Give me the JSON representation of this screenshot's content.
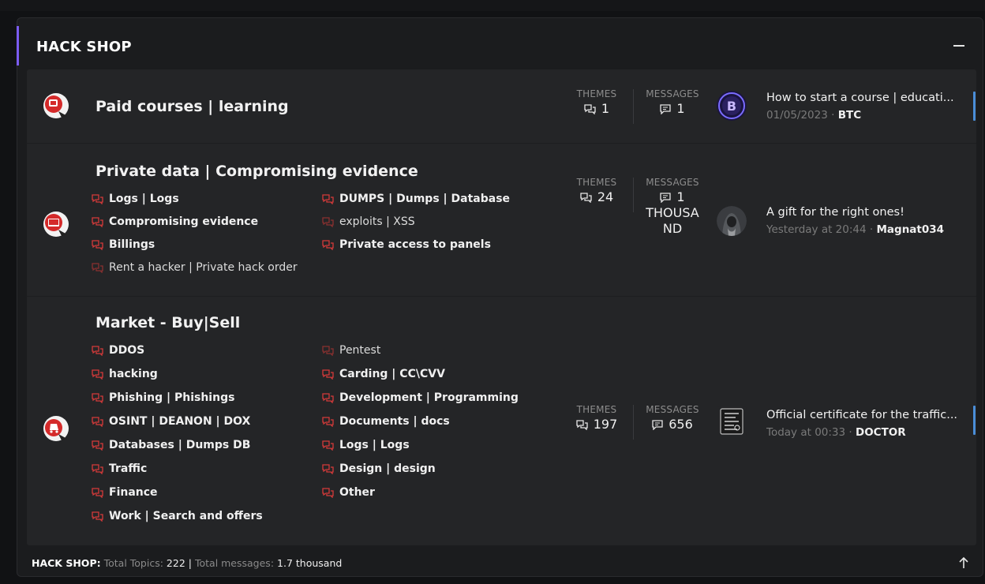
{
  "section": {
    "title": "HACK SHOP",
    "accent_color": "#7b5cf0",
    "collapse_icon": "minus-icon"
  },
  "forums": [
    {
      "title": "Paid courses | learning",
      "icon": "forum-courses-icon",
      "subforums_left": [],
      "subforums_right": [],
      "themes_label": "THEMES",
      "themes": "1",
      "messages_label": "MESSAGES",
      "messages": "1",
      "last_post": {
        "title": "How to start a course | educati...",
        "date": "01/05/2023",
        "sep": "·",
        "author": "BTC",
        "avatar": "btc-avatar"
      }
    },
    {
      "title": "Private data | Compromising evidence",
      "icon": "forum-private-data-icon",
      "subforums_left": [
        {
          "label": "Logs | Logs",
          "bold": true
        },
        {
          "label": "Compromising evidence",
          "bold": true
        },
        {
          "label": "Billings",
          "bold": true
        },
        {
          "label": "Rent a hacker | Private hack order",
          "bold": false
        }
      ],
      "subforums_right": [
        {
          "label": "DUMPS | Dumps | Database",
          "bold": true
        },
        {
          "label": "exploits | XSS",
          "bold": false
        },
        {
          "label": "Private access to panels",
          "bold": true
        }
      ],
      "themes_label": "THEMES",
      "themes": "24",
      "messages_label": "MESSAGES",
      "messages": "1",
      "messages_line2": "THOUSA",
      "messages_line3": "ND",
      "last_post": {
        "title": "A gift for the right ones!",
        "date": "Yesterday at 20:44",
        "sep": "·",
        "author": "Magnat034",
        "avatar": "hooded-figure-avatar"
      }
    },
    {
      "title": "Market - Buy|Sell",
      "icon": "forum-market-icon",
      "subforums_left": [
        {
          "label": "DDOS",
          "bold": true
        },
        {
          "label": "hacking",
          "bold": true
        },
        {
          "label": "Phishing | Phishings",
          "bold": true
        },
        {
          "label": "OSINT | DEANON | DOX",
          "bold": true
        },
        {
          "label": "Databases | Dumps DB",
          "bold": true
        },
        {
          "label": "Traffic",
          "bold": true
        },
        {
          "label": "Finance",
          "bold": true
        },
        {
          "label": "Work | Search and offers",
          "bold": true
        }
      ],
      "subforums_right": [
        {
          "label": "Pentest",
          "bold": false
        },
        {
          "label": "Carding | CC\\CVV",
          "bold": true
        },
        {
          "label": "Development | Programming",
          "bold": true
        },
        {
          "label": "Documents | docs",
          "bold": true
        },
        {
          "label": "Logs | Logs",
          "bold": true
        },
        {
          "label": "Design | design",
          "bold": true
        },
        {
          "label": "Other",
          "bold": true
        }
      ],
      "themes_label": "THEMES",
      "themes": "197",
      "messages_label": "MESSAGES",
      "messages": "656",
      "last_post": {
        "title": "Official certificate for the traffic...",
        "date": "Today at 00:33",
        "sep": "·",
        "author": "DOCTOR",
        "avatar": "certificate-avatar"
      }
    }
  ],
  "footer": {
    "section_label": "HACK SHOP:",
    "topics_label": "Total Topics:",
    "topics_value": "222",
    "separator": "|",
    "messages_label": "Total messages:",
    "messages_value": "1.7 thousand",
    "scroll_up_icon": "arrow-up-icon"
  },
  "colors": {
    "subforum_icon": "#d43a3a",
    "background": "#242527",
    "accent_marker": "#4a8ed8"
  }
}
